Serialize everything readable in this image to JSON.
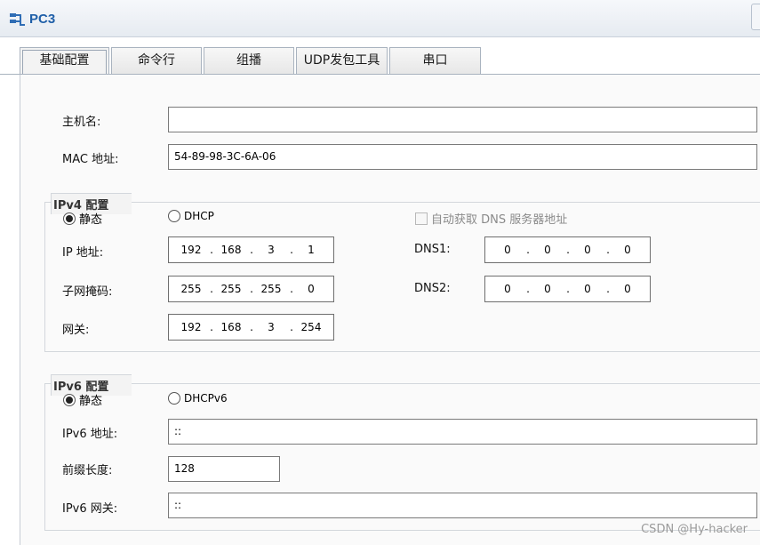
{
  "window": {
    "title": "PC3"
  },
  "tabs": [
    {
      "label": "基础配置",
      "active": true
    },
    {
      "label": "命令行",
      "active": false
    },
    {
      "label": "组播",
      "active": false
    },
    {
      "label": "UDP发包工具",
      "active": false
    },
    {
      "label": "串口",
      "active": false
    }
  ],
  "host": {
    "hostname_label": "主机名:",
    "hostname_value": "",
    "mac_label": "MAC 地址:",
    "mac_value": "54-89-98-3C-6A-06"
  },
  "ipv4": {
    "title": "IPv4 配置",
    "static_label": "静态",
    "dhcp_label": "DHCP",
    "mode": "static",
    "auto_dns_label": "自动获取 DNS 服务器地址",
    "auto_dns_checked": false,
    "ip_label": "IP 地址:",
    "ip": [
      "192",
      "168",
      "3",
      "1"
    ],
    "mask_label": "子网掩码:",
    "mask": [
      "255",
      "255",
      "255",
      "0"
    ],
    "gateway_label": "网关:",
    "gateway": [
      "192",
      "168",
      "3",
      "254"
    ],
    "dns1_label": "DNS1:",
    "dns1": [
      "0",
      "0",
      "0",
      "0"
    ],
    "dns2_label": "DNS2:",
    "dns2": [
      "0",
      "0",
      "0",
      "0"
    ]
  },
  "ipv6": {
    "title": "IPv6 配置",
    "static_label": "静态",
    "dhcp_label": "DHCPv6",
    "mode": "static",
    "addr_label": "IPv6 地址:",
    "addr_value": "::",
    "prefix_label": "前缀长度:",
    "prefix_value": "128",
    "gateway_label": "IPv6 网关:",
    "gateway_value": "::"
  },
  "watermark": "CSDN @Hy-hacker",
  "colors": {
    "title": "#1f5fa8",
    "border": "#a9b3bf",
    "panel": "#fafafa"
  }
}
